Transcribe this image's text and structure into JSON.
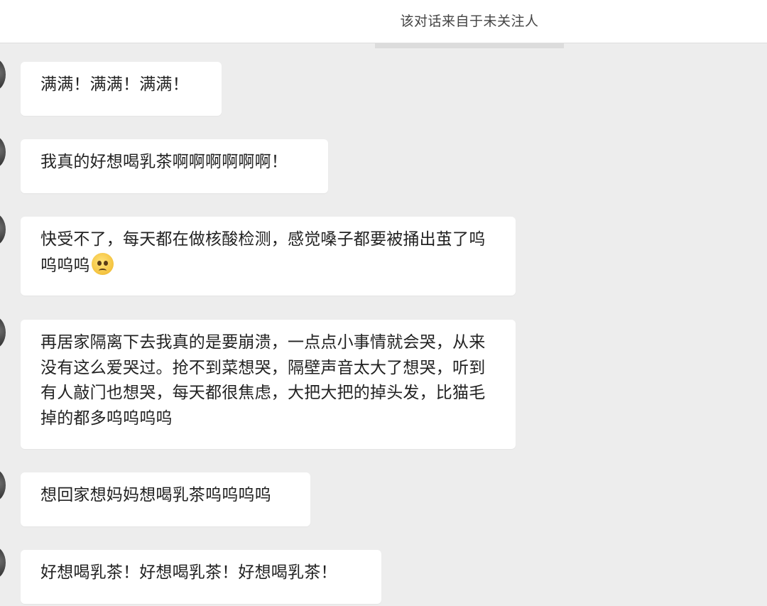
{
  "header": {
    "notice": "该对话来自于未关注人"
  },
  "messages": [
    {
      "text": "满满！满满！满满！"
    },
    {
      "text": "我真的好想喝乳茶啊啊啊啊啊啊！"
    },
    {
      "text": "快受不了，每天都在做核酸检测，感觉嗓子都要被捅出茧了呜呜呜呜",
      "emoji": "pleading-face-emoji"
    },
    {
      "text": "再居家隔离下去我真的是要崩溃，一点点小事情就会哭，从来没有这么爱哭过。抢不到菜想哭，隔壁声音太大了想哭，听到有人敲门也想哭，每天都很焦虑，大把大把的掉头发，比猫毛掉的都多呜呜呜呜"
    },
    {
      "text": "想回家想妈妈想喝乳茶呜呜呜呜"
    },
    {
      "text": "好想喝乳茶！好想喝乳茶！好想喝乳茶！"
    }
  ],
  "colors": {
    "background": "#ededed",
    "bubble": "#ffffff",
    "text": "#222222"
  }
}
